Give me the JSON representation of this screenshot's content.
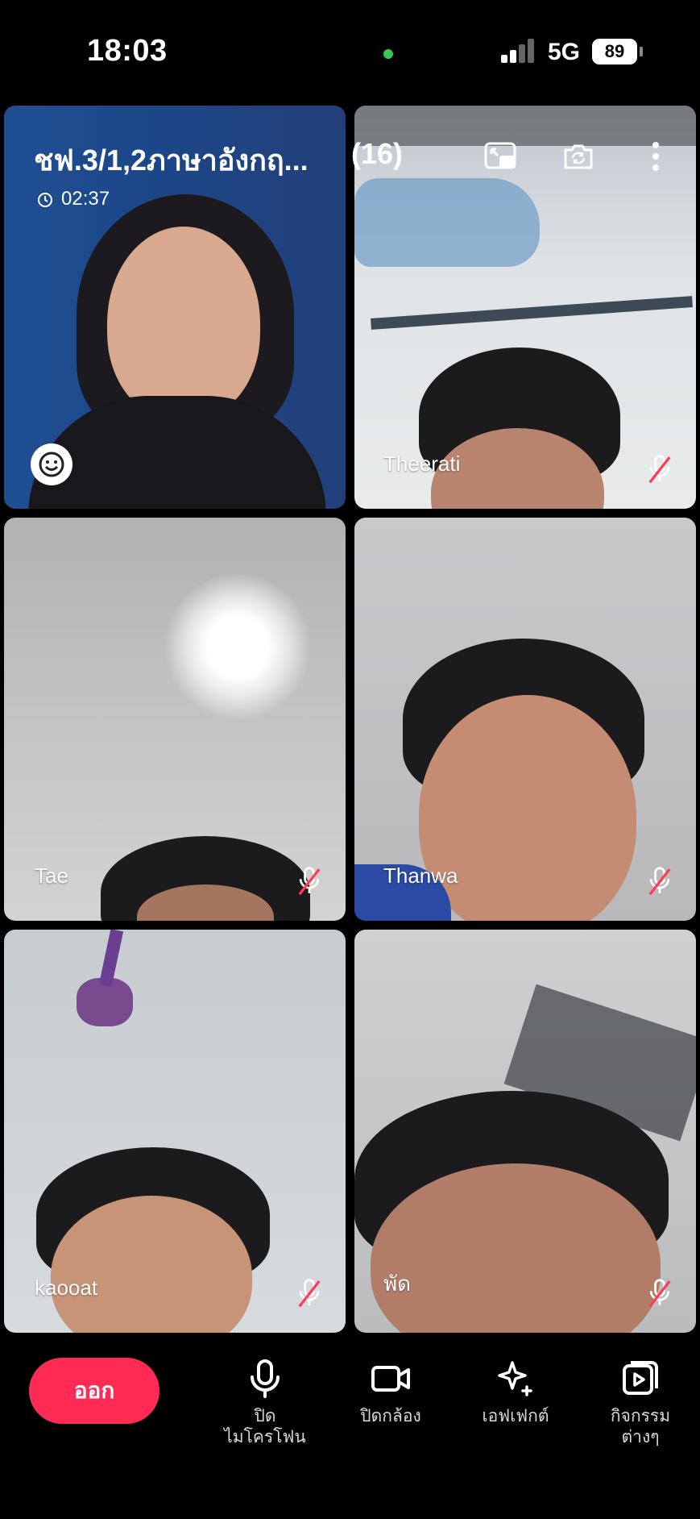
{
  "status_bar": {
    "time": "18:03",
    "network": "5G",
    "battery": "89"
  },
  "call": {
    "title": "ชฟ.3/1,2ภาษาอังกฤ...",
    "participant_count": "(16)",
    "duration": "02:37"
  },
  "participants": [
    {
      "name": ""
    },
    {
      "name": "Theerati",
      "muted": true
    },
    {
      "name": "Tae",
      "muted": true
    },
    {
      "name": "Thanwa",
      "muted": true
    },
    {
      "name": "kaooat",
      "muted": true
    },
    {
      "name": "พัด",
      "muted": true
    }
  ],
  "controls": {
    "leave": "ออก",
    "mic_line1": "ปิด",
    "mic_line2": "ไมโครโฟน",
    "camera": "ปิดกล้อง",
    "effects": "เอฟเฟกต์",
    "activities_line1": "กิจกรรม",
    "activities_line2": "ต่างๆ"
  },
  "icons": {
    "header": [
      "picture-in-picture-icon",
      "switch-camera-icon",
      "more-vert-icon"
    ],
    "controls": [
      "microphone-icon",
      "video-camera-icon",
      "sparkle-icon",
      "activities-icon"
    ]
  },
  "colors": {
    "leave_button": "#fe2c55",
    "status_dot": "#34c759"
  }
}
